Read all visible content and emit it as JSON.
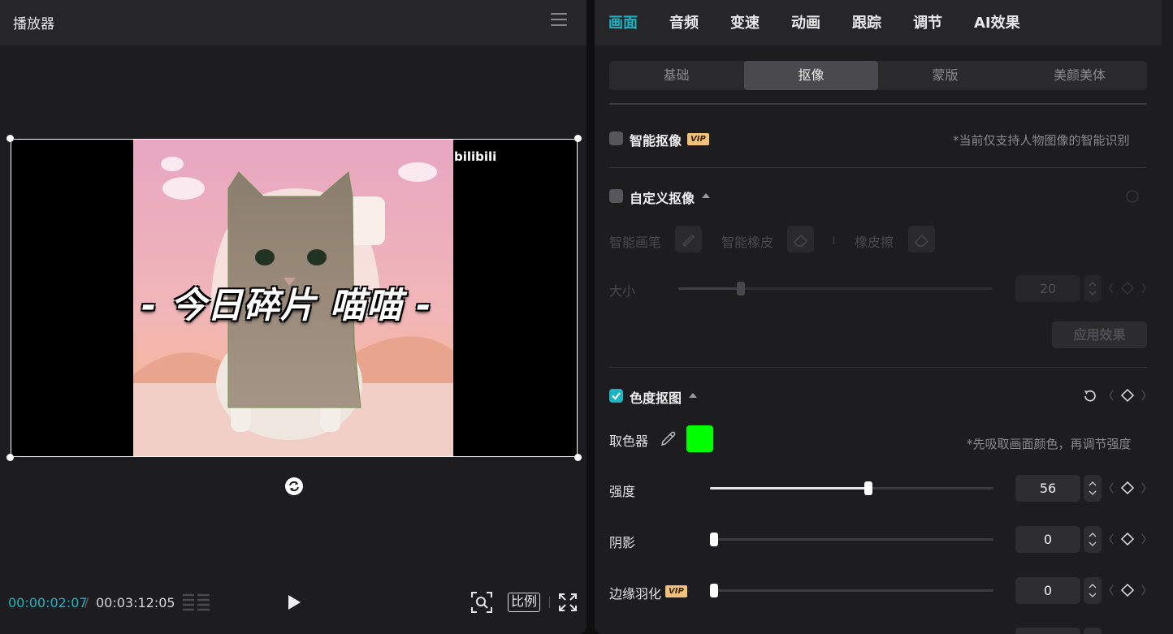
{
  "player": {
    "title": "播放器",
    "overlay_title": "- 今日碎片 喵喵 -",
    "watermark": "bilibili",
    "current_time": "00:00:02:07",
    "separator": "/",
    "total_time": "00:03:12:05",
    "ratio_label": "比例"
  },
  "tabs": [
    "画面",
    "音频",
    "变速",
    "动画",
    "跟踪",
    "调节",
    "AI效果"
  ],
  "active_tab": "画面",
  "subtabs": [
    "基础",
    "抠像",
    "蒙版",
    "美颜美体"
  ],
  "active_subtab": "抠像",
  "smart_cutout": {
    "label": "智能抠像",
    "badge": "VIP",
    "checked": false,
    "hint": "*当前仅支持人物图像的智能识别"
  },
  "custom_cutout": {
    "label": "自定义抠像",
    "checked": false,
    "tools": [
      "智能画笔",
      "智能橡皮",
      "橡皮擦"
    ],
    "size_label": "大小",
    "size_value": "20",
    "size_fraction": 0.2,
    "apply_label": "应用效果"
  },
  "chroma_key": {
    "label": "色度抠图",
    "checked": true,
    "picker_label": "取色器",
    "picked_color": "#00ff00",
    "picker_hint": "*先吸取画面颜色，再调节强度",
    "sliders": [
      {
        "label": "强度",
        "value": "56",
        "fraction": 0.56,
        "badge": ""
      },
      {
        "label": "阴影",
        "value": "0",
        "fraction": 0,
        "badge": ""
      },
      {
        "label": "边缘羽化",
        "value": "0",
        "fraction": 0,
        "badge": "VIP"
      }
    ]
  },
  "colors": {
    "accent": "#1bb5c4",
    "vip": "#f0c27a"
  }
}
